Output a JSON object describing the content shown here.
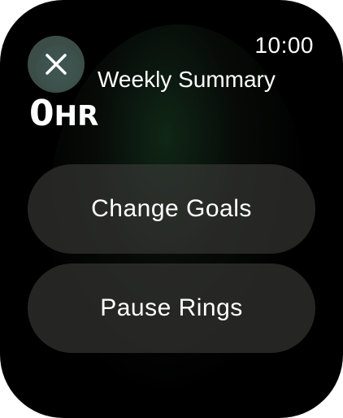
{
  "status_bar": {
    "time": "10:00"
  },
  "header": {
    "close_icon": "close-icon",
    "title": "Weekly Summary"
  },
  "summary": {
    "value": "0",
    "unit": "HR"
  },
  "actions": {
    "change_goals_label": "Change Goals",
    "pause_rings_label": "Pause Rings"
  },
  "colors": {
    "background": "#000000",
    "button_fill": "#3c3c3a",
    "close_button_fill": "#465a55",
    "text": "#ffffff"
  }
}
